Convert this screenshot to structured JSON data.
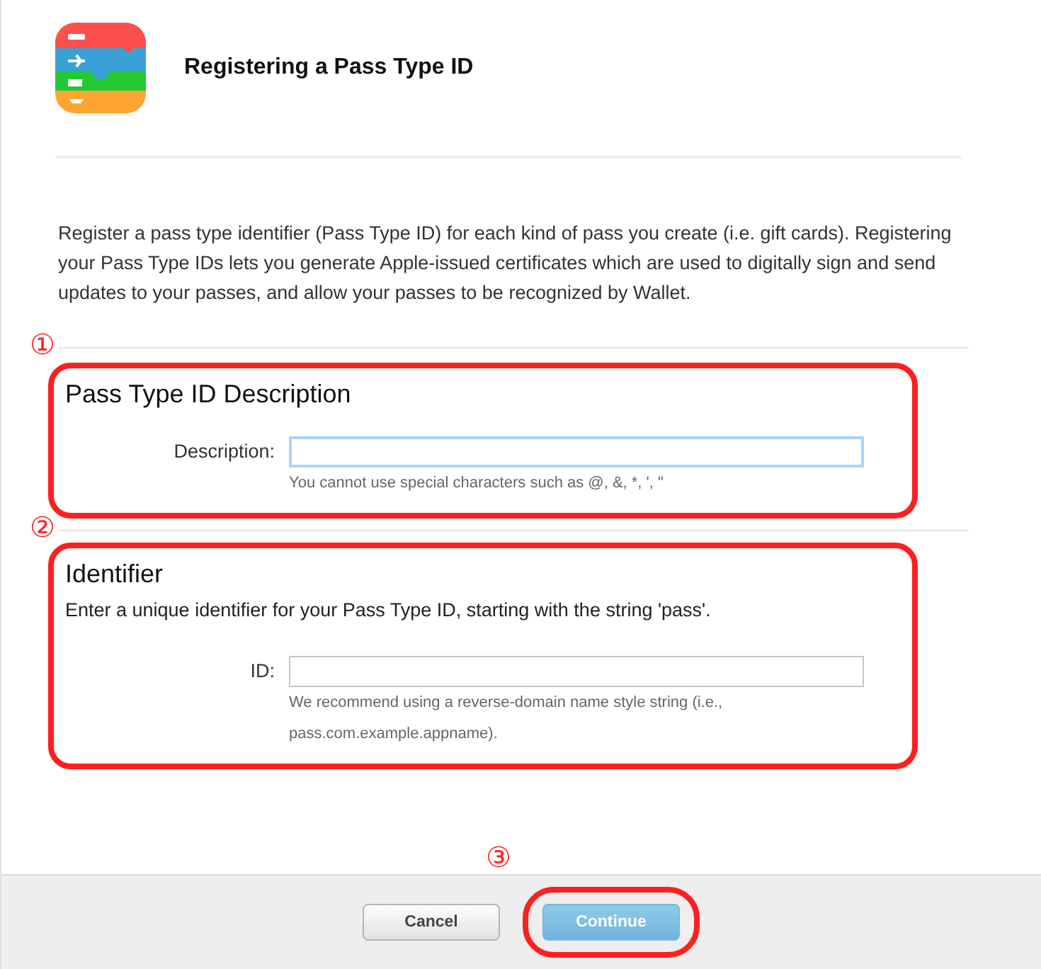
{
  "header": {
    "title": "Registering a Pass Type ID"
  },
  "intro": "Register a pass type identifier (Pass Type ID) for each kind of pass you create (i.e. gift cards). Registering your Pass Type IDs lets you generate Apple-issued certificates which are used to digitally sign and send updates to your passes, and allow your passes to be recognized by Wallet.",
  "sections": [
    {
      "marker": "①",
      "title": "Pass Type ID Description",
      "field_label": "Description:",
      "focused": true,
      "hint_lines": [
        "You cannot use special characters such as @, &, *, ', \""
      ]
    },
    {
      "marker": "②",
      "title": "Identifier",
      "subtitle": "Enter a unique identifier for your Pass Type ID, starting with the string 'pass'.",
      "field_label": "ID:",
      "focused": false,
      "hint_lines": [
        "We recommend using a reverse-domain name style string (i.e.,",
        "pass.com.example.appname)."
      ]
    }
  ],
  "footer": {
    "buttons": [
      {
        "label": "Cancel",
        "kind": "secondary"
      },
      {
        "label": "Continue",
        "kind": "primary",
        "marker": "③"
      }
    ]
  }
}
